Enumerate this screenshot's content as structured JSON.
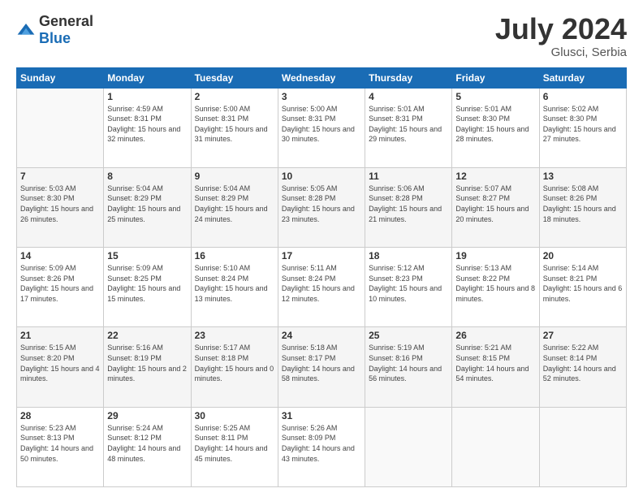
{
  "logo": {
    "general": "General",
    "blue": "Blue"
  },
  "title": {
    "month_year": "July 2024",
    "location": "Glusci, Serbia"
  },
  "weekdays": [
    "Sunday",
    "Monday",
    "Tuesday",
    "Wednesday",
    "Thursday",
    "Friday",
    "Saturday"
  ],
  "weeks": [
    [
      {
        "day": "",
        "sunrise": "",
        "sunset": "",
        "daylight": ""
      },
      {
        "day": "1",
        "sunrise": "Sunrise: 4:59 AM",
        "sunset": "Sunset: 8:31 PM",
        "daylight": "Daylight: 15 hours and 32 minutes."
      },
      {
        "day": "2",
        "sunrise": "Sunrise: 5:00 AM",
        "sunset": "Sunset: 8:31 PM",
        "daylight": "Daylight: 15 hours and 31 minutes."
      },
      {
        "day": "3",
        "sunrise": "Sunrise: 5:00 AM",
        "sunset": "Sunset: 8:31 PM",
        "daylight": "Daylight: 15 hours and 30 minutes."
      },
      {
        "day": "4",
        "sunrise": "Sunrise: 5:01 AM",
        "sunset": "Sunset: 8:31 PM",
        "daylight": "Daylight: 15 hours and 29 minutes."
      },
      {
        "day": "5",
        "sunrise": "Sunrise: 5:01 AM",
        "sunset": "Sunset: 8:30 PM",
        "daylight": "Daylight: 15 hours and 28 minutes."
      },
      {
        "day": "6",
        "sunrise": "Sunrise: 5:02 AM",
        "sunset": "Sunset: 8:30 PM",
        "daylight": "Daylight: 15 hours and 27 minutes."
      }
    ],
    [
      {
        "day": "7",
        "sunrise": "Sunrise: 5:03 AM",
        "sunset": "Sunset: 8:30 PM",
        "daylight": "Daylight: 15 hours and 26 minutes."
      },
      {
        "day": "8",
        "sunrise": "Sunrise: 5:04 AM",
        "sunset": "Sunset: 8:29 PM",
        "daylight": "Daylight: 15 hours and 25 minutes."
      },
      {
        "day": "9",
        "sunrise": "Sunrise: 5:04 AM",
        "sunset": "Sunset: 8:29 PM",
        "daylight": "Daylight: 15 hours and 24 minutes."
      },
      {
        "day": "10",
        "sunrise": "Sunrise: 5:05 AM",
        "sunset": "Sunset: 8:28 PM",
        "daylight": "Daylight: 15 hours and 23 minutes."
      },
      {
        "day": "11",
        "sunrise": "Sunrise: 5:06 AM",
        "sunset": "Sunset: 8:28 PM",
        "daylight": "Daylight: 15 hours and 21 minutes."
      },
      {
        "day": "12",
        "sunrise": "Sunrise: 5:07 AM",
        "sunset": "Sunset: 8:27 PM",
        "daylight": "Daylight: 15 hours and 20 minutes."
      },
      {
        "day": "13",
        "sunrise": "Sunrise: 5:08 AM",
        "sunset": "Sunset: 8:26 PM",
        "daylight": "Daylight: 15 hours and 18 minutes."
      }
    ],
    [
      {
        "day": "14",
        "sunrise": "Sunrise: 5:09 AM",
        "sunset": "Sunset: 8:26 PM",
        "daylight": "Daylight: 15 hours and 17 minutes."
      },
      {
        "day": "15",
        "sunrise": "Sunrise: 5:09 AM",
        "sunset": "Sunset: 8:25 PM",
        "daylight": "Daylight: 15 hours and 15 minutes."
      },
      {
        "day": "16",
        "sunrise": "Sunrise: 5:10 AM",
        "sunset": "Sunset: 8:24 PM",
        "daylight": "Daylight: 15 hours and 13 minutes."
      },
      {
        "day": "17",
        "sunrise": "Sunrise: 5:11 AM",
        "sunset": "Sunset: 8:24 PM",
        "daylight": "Daylight: 15 hours and 12 minutes."
      },
      {
        "day": "18",
        "sunrise": "Sunrise: 5:12 AM",
        "sunset": "Sunset: 8:23 PM",
        "daylight": "Daylight: 15 hours and 10 minutes."
      },
      {
        "day": "19",
        "sunrise": "Sunrise: 5:13 AM",
        "sunset": "Sunset: 8:22 PM",
        "daylight": "Daylight: 15 hours and 8 minutes."
      },
      {
        "day": "20",
        "sunrise": "Sunrise: 5:14 AM",
        "sunset": "Sunset: 8:21 PM",
        "daylight": "Daylight: 15 hours and 6 minutes."
      }
    ],
    [
      {
        "day": "21",
        "sunrise": "Sunrise: 5:15 AM",
        "sunset": "Sunset: 8:20 PM",
        "daylight": "Daylight: 15 hours and 4 minutes."
      },
      {
        "day": "22",
        "sunrise": "Sunrise: 5:16 AM",
        "sunset": "Sunset: 8:19 PM",
        "daylight": "Daylight: 15 hours and 2 minutes."
      },
      {
        "day": "23",
        "sunrise": "Sunrise: 5:17 AM",
        "sunset": "Sunset: 8:18 PM",
        "daylight": "Daylight: 15 hours and 0 minutes."
      },
      {
        "day": "24",
        "sunrise": "Sunrise: 5:18 AM",
        "sunset": "Sunset: 8:17 PM",
        "daylight": "Daylight: 14 hours and 58 minutes."
      },
      {
        "day": "25",
        "sunrise": "Sunrise: 5:19 AM",
        "sunset": "Sunset: 8:16 PM",
        "daylight": "Daylight: 14 hours and 56 minutes."
      },
      {
        "day": "26",
        "sunrise": "Sunrise: 5:21 AM",
        "sunset": "Sunset: 8:15 PM",
        "daylight": "Daylight: 14 hours and 54 minutes."
      },
      {
        "day": "27",
        "sunrise": "Sunrise: 5:22 AM",
        "sunset": "Sunset: 8:14 PM",
        "daylight": "Daylight: 14 hours and 52 minutes."
      }
    ],
    [
      {
        "day": "28",
        "sunrise": "Sunrise: 5:23 AM",
        "sunset": "Sunset: 8:13 PM",
        "daylight": "Daylight: 14 hours and 50 minutes."
      },
      {
        "day": "29",
        "sunrise": "Sunrise: 5:24 AM",
        "sunset": "Sunset: 8:12 PM",
        "daylight": "Daylight: 14 hours and 48 minutes."
      },
      {
        "day": "30",
        "sunrise": "Sunrise: 5:25 AM",
        "sunset": "Sunset: 8:11 PM",
        "daylight": "Daylight: 14 hours and 45 minutes."
      },
      {
        "day": "31",
        "sunrise": "Sunrise: 5:26 AM",
        "sunset": "Sunset: 8:09 PM",
        "daylight": "Daylight: 14 hours and 43 minutes."
      },
      {
        "day": "",
        "sunrise": "",
        "sunset": "",
        "daylight": ""
      },
      {
        "day": "",
        "sunrise": "",
        "sunset": "",
        "daylight": ""
      },
      {
        "day": "",
        "sunrise": "",
        "sunset": "",
        "daylight": ""
      }
    ]
  ]
}
